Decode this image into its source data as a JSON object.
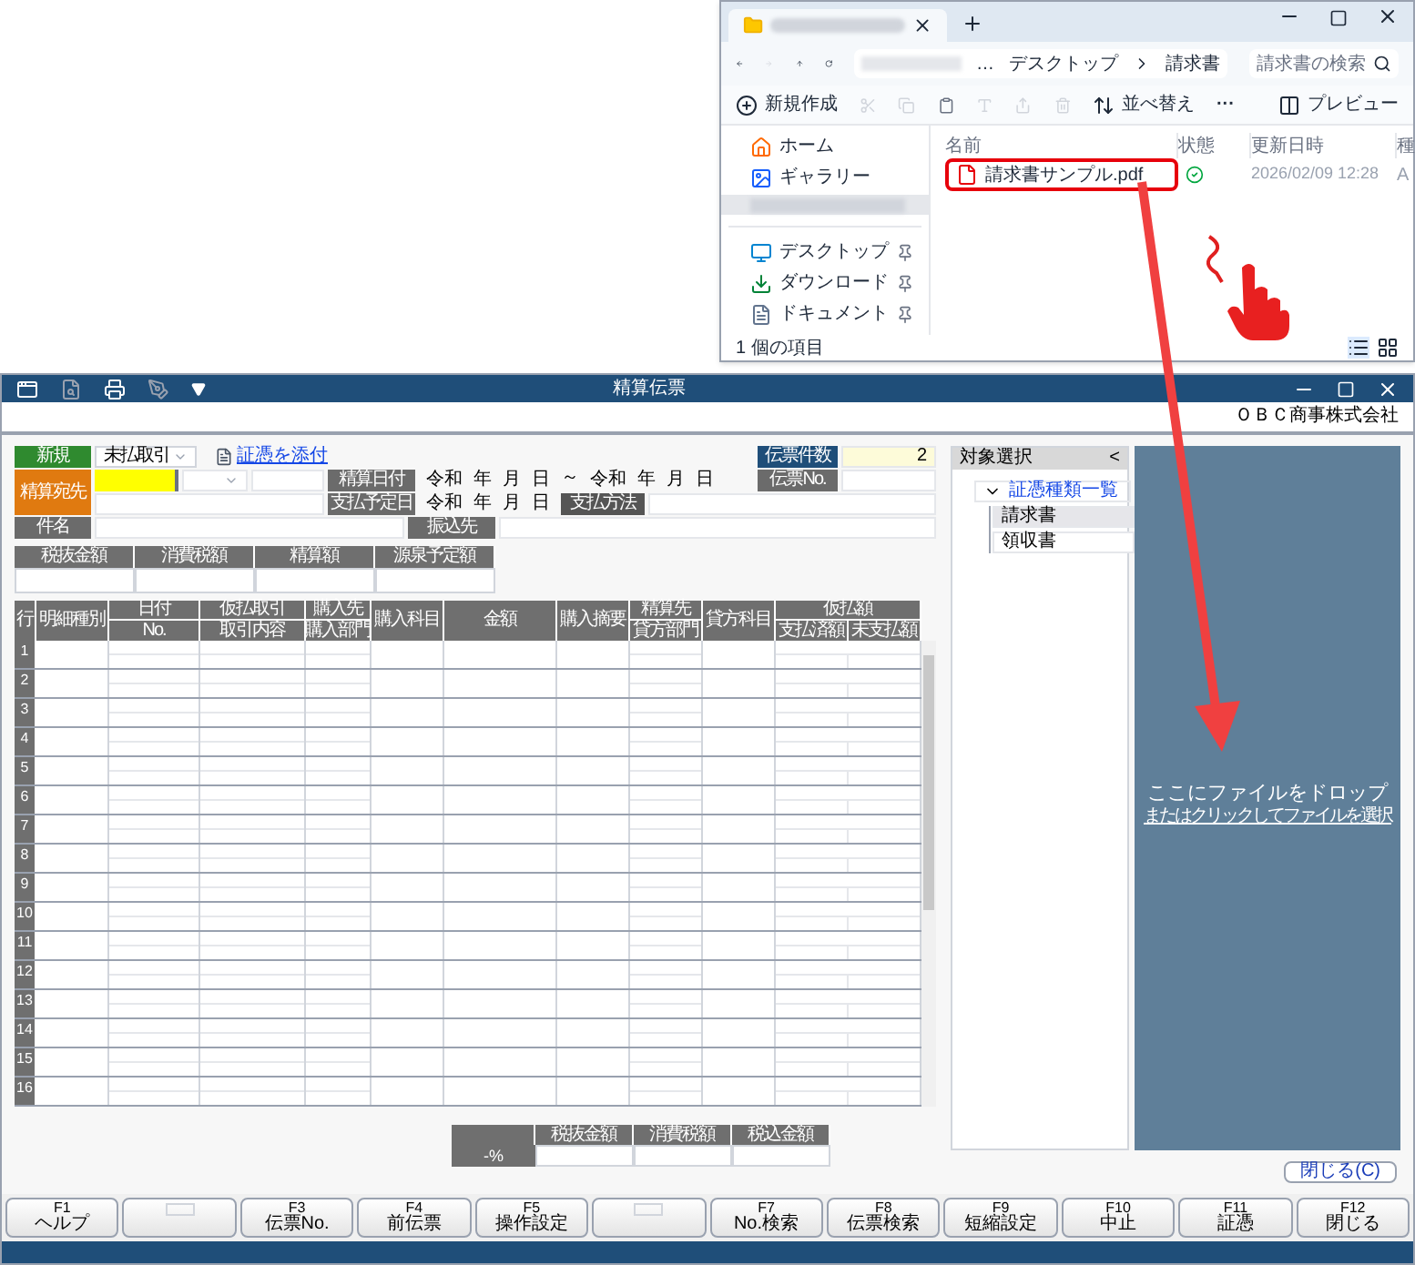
{
  "explorer": {
    "breadcrumb": [
      "…",
      "デスクトップ",
      "請求書"
    ],
    "search_placeholder": "請求書の検索",
    "toolbar": {
      "new": "新規作成",
      "sort": "並べ替え",
      "more": "···",
      "preview": "プレビュー"
    },
    "nav": [
      {
        "kind": "home",
        "label": "ホーム",
        "selected": false,
        "pinned": false
      },
      {
        "kind": "gallery",
        "label": "ギャラリー",
        "selected": false,
        "pinned": false
      },
      {
        "kind": "redacted",
        "selected": true,
        "pinned": false
      },
      {
        "kind": "desktop",
        "label": "デスクトップ",
        "selected": false,
        "pinned": true
      },
      {
        "kind": "download",
        "label": "ダウンロード",
        "selected": false,
        "pinned": true
      },
      {
        "kind": "document",
        "label": "ドキュメント",
        "selected": false,
        "pinned": true
      }
    ],
    "columns": [
      "名前",
      "状態",
      "更新日時",
      "種"
    ],
    "files": [
      {
        "name": "請求書サンプル.pdf",
        "synced": true,
        "modified": "2026/02/09 12:28",
        "column_4": "A",
        "highlighted": true
      }
    ],
    "status": "1 個の項目"
  },
  "app": {
    "title": "精算伝票",
    "company": "ＯＢＣ商事株式会社",
    "form": {
      "mode": "新規",
      "trade_type": "未払取引",
      "attach_link": "証憑を添付",
      "payee": "精算宛先",
      "subject": "件名",
      "settle_date": "精算日付",
      "pay_date": "支払予定日",
      "pay_method": "支払方法",
      "transfer_to": "振込先",
      "settle_from": [
        "令和",
        "年",
        "月",
        "日"
      ],
      "range_sep": "～",
      "settle_to": [
        "令和",
        "年",
        "月",
        "日"
      ],
      "pay_parts": [
        "令和",
        "年",
        "月",
        "日"
      ],
      "count_label": "伝票件数",
      "count_value": "2",
      "voucher_no": "伝票No."
    },
    "summary": [
      "税抜金額",
      "消費税額",
      "精算額",
      "源泉予定額"
    ],
    "columns": [
      {
        "top": "行"
      },
      {
        "top": "明細種別"
      },
      {
        "top": "日付",
        "bottom": "No."
      },
      {
        "top": "仮払取引",
        "bottom": "取引内容"
      },
      {
        "top": "購入先",
        "bottom": "購入部門"
      },
      {
        "top": "購入科目"
      },
      {
        "top": "金額"
      },
      {
        "top": "購入摘要"
      },
      {
        "top": "精算先",
        "bottom": "貸方部門"
      },
      {
        "top": "貸方科目"
      },
      {
        "top": "仮払額",
        "children": [
          "支払済額",
          "未支払額"
        ]
      }
    ],
    "rows": [
      "1",
      "2",
      "3",
      "4",
      "5",
      "6",
      "7",
      "8",
      "9",
      "10",
      "11",
      "12",
      "13",
      "14",
      "15",
      "16"
    ],
    "totals": {
      "rate": "-%",
      "headers": [
        "税抜金額",
        "消費税額",
        "税込金額"
      ]
    },
    "side_panel": {
      "title": "対象選択",
      "collapse": "<",
      "tree": [
        {
          "label": "証憑種類一覧",
          "expanded": true,
          "children": [
            {
              "label": "請求書",
              "selected": true
            },
            {
              "label": "領収書",
              "selected": false
            }
          ]
        }
      ]
    },
    "drop_zone": {
      "title": "ここにファイルをドロップ",
      "link": "またはクリックしてファイルを選択"
    },
    "close_button": "閉じる(C)",
    "function_keys": [
      {
        "kind": "key",
        "key": "F1",
        "label": "ヘルプ"
      },
      {
        "kind": "blank"
      },
      {
        "kind": "key",
        "key": "F3",
        "label": "伝票No."
      },
      {
        "kind": "key",
        "key": "F4",
        "label": "前伝票"
      },
      {
        "kind": "key",
        "key": "F5",
        "label": "操作設定"
      },
      {
        "kind": "blank"
      },
      {
        "kind": "key",
        "key": "F7",
        "label": "No.検索"
      },
      {
        "kind": "key",
        "key": "F8",
        "label": "伝票検索"
      },
      {
        "kind": "key",
        "key": "F9",
        "label": "短縮設定"
      },
      {
        "kind": "key",
        "key": "F10",
        "label": "中止"
      },
      {
        "kind": "key",
        "key": "F11",
        "label": "証憑"
      },
      {
        "kind": "key",
        "key": "F12",
        "label": "閉じる"
      }
    ]
  }
}
